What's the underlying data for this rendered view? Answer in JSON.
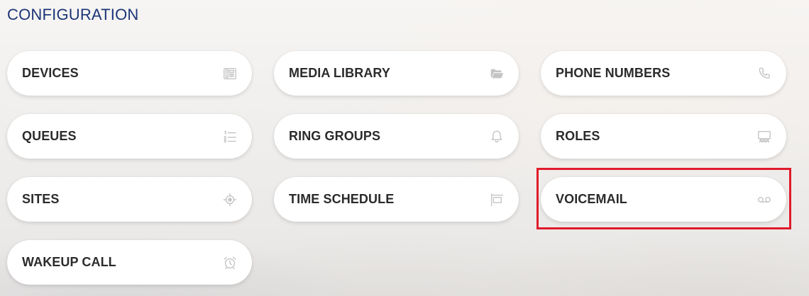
{
  "section": {
    "title": "CONFIGURATION"
  },
  "tiles": [
    {
      "label": "DEVICES",
      "icon": "desk-phone-icon"
    },
    {
      "label": "MEDIA LIBRARY",
      "icon": "folder-open-icon"
    },
    {
      "label": "PHONE NUMBERS",
      "icon": "phone-icon"
    },
    {
      "label": "QUEUES",
      "icon": "numbered-list-icon"
    },
    {
      "label": "RING GROUPS",
      "icon": "bell-icon"
    },
    {
      "label": "ROLES",
      "icon": "roles-icon"
    },
    {
      "label": "SITES",
      "icon": "crosshair-icon"
    },
    {
      "label": "TIME SCHEDULE",
      "icon": "time-schedule-icon"
    },
    {
      "label": "VOICEMAIL",
      "icon": "voicemail-icon"
    },
    {
      "label": "WAKEUP CALL",
      "icon": "alarm-clock-icon"
    }
  ],
  "highlight": {
    "target": "VOICEMAIL",
    "color": "#e01b2b"
  },
  "colors": {
    "title": "#1c3578",
    "tile_background": "#ffffff",
    "tile_text": "#2b2b2b",
    "icon": "#c4c4c4"
  }
}
